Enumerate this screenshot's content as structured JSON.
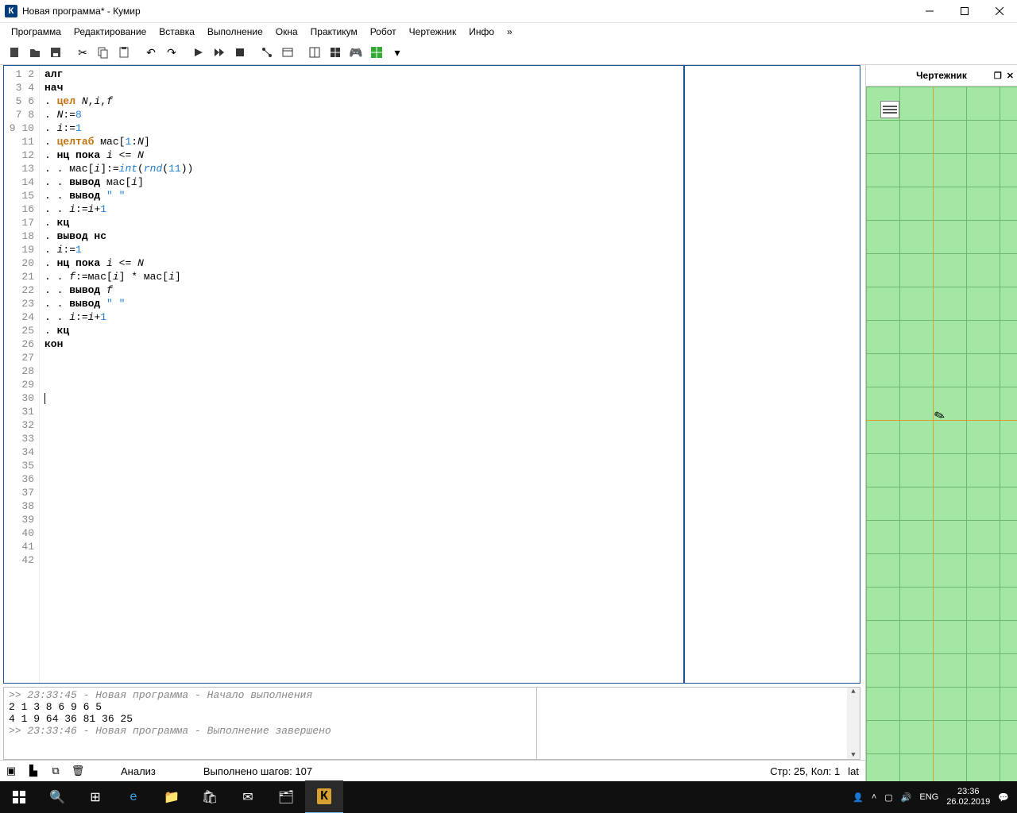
{
  "window": {
    "title": "Новая программа* - Кумир"
  },
  "menu": [
    "Программа",
    "Редактирование",
    "Вставка",
    "Выполнение",
    "Окна",
    "Практикум",
    "Робот",
    "Чертежник",
    "Инфо",
    "»"
  ],
  "right_panel": {
    "title": "Чертежник"
  },
  "gutter_max": 42,
  "code_lines": [
    [
      {
        "t": "алг",
        "c": "kw"
      }
    ],
    [
      {
        "t": "нач",
        "c": "kw"
      }
    ],
    [
      {
        "t": ". "
      },
      {
        "t": "цел",
        "c": "ty"
      },
      {
        "t": " "
      },
      {
        "t": "N",
        "c": "it"
      },
      {
        "t": ","
      },
      {
        "t": "i",
        "c": "it"
      },
      {
        "t": ","
      },
      {
        "t": "f",
        "c": "it"
      }
    ],
    [
      {
        "t": ". "
      },
      {
        "t": "N",
        "c": "it"
      },
      {
        "t": ":="
      },
      {
        "t": "8",
        "c": "nm"
      }
    ],
    [
      {
        "t": ". "
      },
      {
        "t": "i",
        "c": "it"
      },
      {
        "t": ":="
      },
      {
        "t": "1",
        "c": "nm"
      }
    ],
    [
      {
        "t": ". "
      },
      {
        "t": "целтаб",
        "c": "ty"
      },
      {
        "t": " мас["
      },
      {
        "t": "1",
        "c": "nm"
      },
      {
        "t": ":"
      },
      {
        "t": "N",
        "c": "it"
      },
      {
        "t": "]"
      }
    ],
    [
      {
        "t": ". "
      },
      {
        "t": "нц пока",
        "c": "kw"
      },
      {
        "t": " "
      },
      {
        "t": "i",
        "c": "it"
      },
      {
        "t": " <= "
      },
      {
        "t": "N",
        "c": "it"
      }
    ],
    [
      {
        "t": ". . мас["
      },
      {
        "t": "i",
        "c": "it"
      },
      {
        "t": "]:="
      },
      {
        "t": "int",
        "c": "it nm"
      },
      {
        "t": "("
      },
      {
        "t": "rnd",
        "c": "it nm"
      },
      {
        "t": "("
      },
      {
        "t": "11",
        "c": "nm"
      },
      {
        "t": "))"
      }
    ],
    [
      {
        "t": ". . "
      },
      {
        "t": "вывод",
        "c": "kw"
      },
      {
        "t": " мас["
      },
      {
        "t": "i",
        "c": "it"
      },
      {
        "t": "]"
      }
    ],
    [
      {
        "t": ". . "
      },
      {
        "t": "вывод",
        "c": "kw"
      },
      {
        "t": " "
      },
      {
        "t": "\" \"",
        "c": "st"
      }
    ],
    [
      {
        "t": ". . "
      },
      {
        "t": "i",
        "c": "it"
      },
      {
        "t": ":="
      },
      {
        "t": "i",
        "c": "it"
      },
      {
        "t": "+"
      },
      {
        "t": "1",
        "c": "nm"
      }
    ],
    [
      {
        "t": ". "
      },
      {
        "t": "кц",
        "c": "kw"
      }
    ],
    [
      {
        "t": ". "
      },
      {
        "t": "вывод нс",
        "c": "kw"
      }
    ],
    [
      {
        "t": ". "
      },
      {
        "t": "i",
        "c": "it"
      },
      {
        "t": ":="
      },
      {
        "t": "1",
        "c": "nm"
      }
    ],
    [
      {
        "t": ". "
      },
      {
        "t": "нц пока",
        "c": "kw"
      },
      {
        "t": " "
      },
      {
        "t": "i",
        "c": "it"
      },
      {
        "t": " <= "
      },
      {
        "t": "N",
        "c": "it"
      }
    ],
    [
      {
        "t": ". . "
      },
      {
        "t": "f",
        "c": "it"
      },
      {
        "t": ":=мас["
      },
      {
        "t": "i",
        "c": "it"
      },
      {
        "t": "] * мас["
      },
      {
        "t": "i",
        "c": "it"
      },
      {
        "t": "]"
      }
    ],
    [
      {
        "t": ". . "
      },
      {
        "t": "вывод",
        "c": "kw"
      },
      {
        "t": " "
      },
      {
        "t": "f",
        "c": "it"
      }
    ],
    [
      {
        "t": ". . "
      },
      {
        "t": "вывод",
        "c": "kw"
      },
      {
        "t": " "
      },
      {
        "t": "\" \"",
        "c": "st"
      }
    ],
    [
      {
        "t": ". . "
      },
      {
        "t": "i",
        "c": "it"
      },
      {
        "t": ":="
      },
      {
        "t": "i",
        "c": "it"
      },
      {
        "t": "+"
      },
      {
        "t": "1",
        "c": "nm"
      }
    ],
    [
      {
        "t": ". "
      },
      {
        "t": "кц",
        "c": "kw"
      }
    ],
    [
      {
        "t": "кон",
        "c": "kw"
      }
    ]
  ],
  "cursor_line": 25,
  "console": {
    "log1": ">> 23:33:45 - Новая программа - Начало выполнения",
    "out1": "2 1 3 8 6 9 6 5 ",
    "out2": "4 1 9 64 36 81 36 25 ",
    "log2": ">> 23:33:46 - Новая программа - Выполнение завершено"
  },
  "status": {
    "analysis": "Анализ",
    "steps": "Выполнено шагов: 107",
    "pos": "Стр: 25, Кол: 1",
    "lang": "lat"
  },
  "taskbar": {
    "tray_lang": "ENG",
    "time": "23:36",
    "date": "26.02.2019"
  }
}
